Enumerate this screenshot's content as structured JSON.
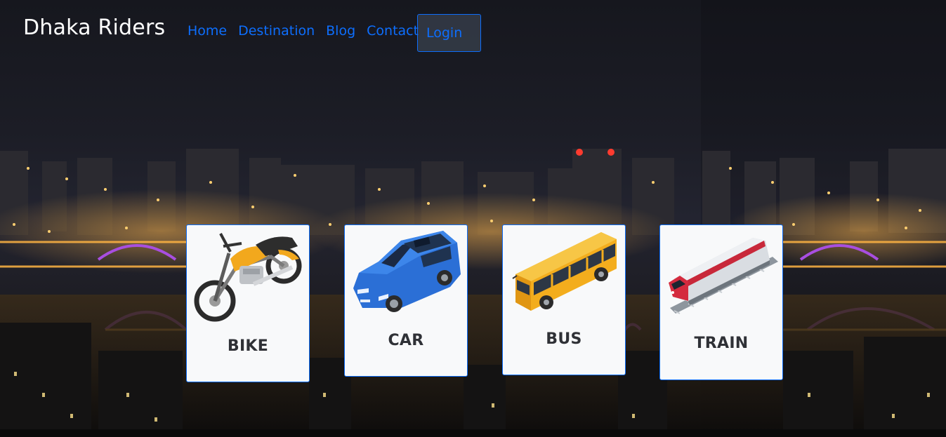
{
  "navbar": {
    "brand": "Dhaka Riders",
    "links": [
      {
        "label": "Home"
      },
      {
        "label": "Destination"
      },
      {
        "label": "Blog"
      },
      {
        "label": "Contact"
      }
    ],
    "login_label": "Login"
  },
  "vehicles": [
    {
      "label": "BIKE",
      "icon": "motorbike-icon"
    },
    {
      "label": "CAR",
      "icon": "car-icon"
    },
    {
      "label": "BUS",
      "icon": "bus-icon"
    },
    {
      "label": "TRAIN",
      "icon": "train-icon"
    }
  ],
  "colors": {
    "link": "#0d6efd",
    "card_border": "#0d6efd",
    "card_bg": "#f8f9fa",
    "brand_text": "#ffffff"
  }
}
